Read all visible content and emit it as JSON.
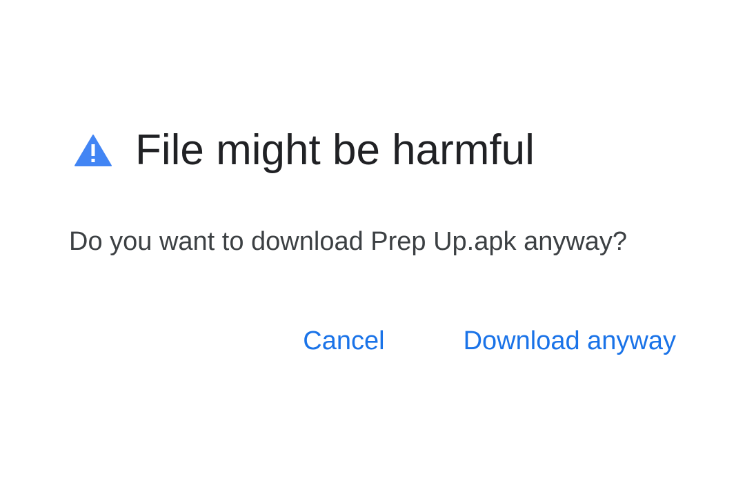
{
  "dialog": {
    "icon": "warning-triangle-icon",
    "icon_color": "#4285f4",
    "title": "File might be harmful",
    "message": "Do you want to download Prep Up.apk anyway?",
    "buttons": {
      "cancel_label": "Cancel",
      "download_label": "Download anyway"
    },
    "accent_color": "#1a73e8"
  }
}
